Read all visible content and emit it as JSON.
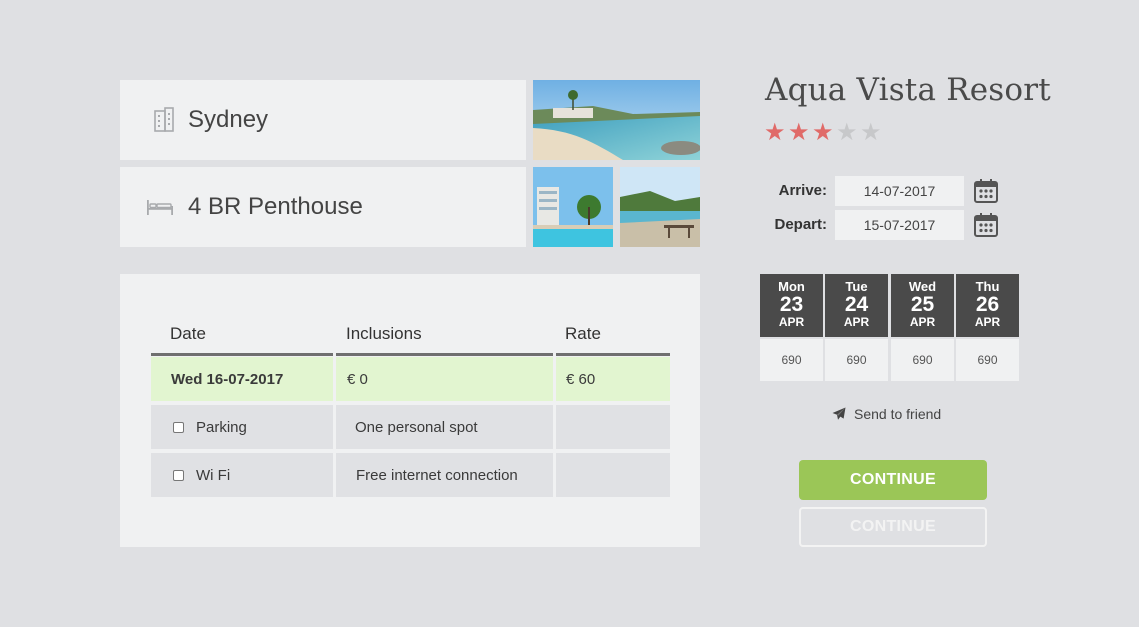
{
  "search": {
    "location": "Sydney",
    "room": "4 BR Penthouse"
  },
  "table": {
    "headers": [
      "Date",
      "Inclusions",
      "Rate"
    ],
    "summary_row": {
      "date": "Wed 16-07-2017",
      "inclusions": "€ 0",
      "rate": "€ 60"
    },
    "options": [
      {
        "label": "Parking",
        "description": "One personal spot",
        "rate": ""
      },
      {
        "label": "Wi Fi",
        "description": "Free internet connection",
        "rate": ""
      }
    ]
  },
  "hotel": {
    "name": "Aqua Vista Resort",
    "rating": 3,
    "max_rating": 5,
    "star_color_on": "#e06a68",
    "star_color_off": "#c7c8ca"
  },
  "dates": {
    "arrive_label": "Arrive:",
    "arrive_value": "14-07-2017",
    "depart_label": "Depart:",
    "depart_value": "15-07-2017"
  },
  "days": [
    {
      "weekday": "Mon",
      "day": "23",
      "month": "APR",
      "price": "690"
    },
    {
      "weekday": "Tue",
      "day": "24",
      "month": "APR",
      "price": "690"
    },
    {
      "weekday": "Wed",
      "day": "25",
      "month": "APR",
      "price": "690"
    },
    {
      "weekday": "Thu",
      "day": "26",
      "month": "APR",
      "price": "690"
    }
  ],
  "actions": {
    "send_to_friend": "Send to friend",
    "continue_primary": "CONTINUE",
    "continue_secondary": "CONTINUE"
  },
  "colors": {
    "accent_green": "#9bc657",
    "row_highlight": "#e2f5d0",
    "day_header": "#4a4a4a"
  }
}
